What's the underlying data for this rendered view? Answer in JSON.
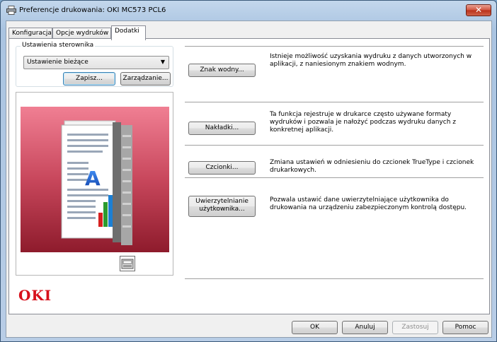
{
  "window": {
    "title": "Preferencje drukowania: OKI MC573 PCL6",
    "close_label": "✕"
  },
  "tabs": [
    {
      "label": "Konfiguracja"
    },
    {
      "label": "Opcje wydruków"
    },
    {
      "label": "Dodatki"
    }
  ],
  "driver_settings": {
    "group_label": "Ustawienia sterownika",
    "selected": "Ustawienie bieżące",
    "save_label": "Zapisz...",
    "manage_label": "Zarządzanie..."
  },
  "features": [
    {
      "button": "Znak wodny...",
      "description": "Istnieje możliwość uzyskania wydruku z danych utworzonych w aplikacji, z naniesionym znakiem wodnym."
    },
    {
      "button": "Nakładki...",
      "description": "Ta funkcja rejestruje w drukarce często używane formaty wydruków i pozwala je nałożyć podczas wydruku danych z konkretnej aplikacji."
    },
    {
      "button": "Czcionki...",
      "description": "Zmiana ustawień w odniesieniu do czcionek TrueType i czcionek drukarkowych."
    },
    {
      "button_line1": "Uwierzytelnianie",
      "button_line2": "użytkownika...",
      "description": "Pozwala ustawić dane uwierzytelniające użytkownika do drukowania na urządzeniu zabezpieczonym kontrolą dostępu."
    }
  ],
  "preview": {
    "letter": "A"
  },
  "brand": {
    "logo_text": "OKI",
    "logo_color": "#d7101b"
  },
  "footer": {
    "ok_label": "OK",
    "cancel_label": "Anuluj",
    "apply_label": "Zastosuj",
    "help_label": "Pomoc"
  }
}
